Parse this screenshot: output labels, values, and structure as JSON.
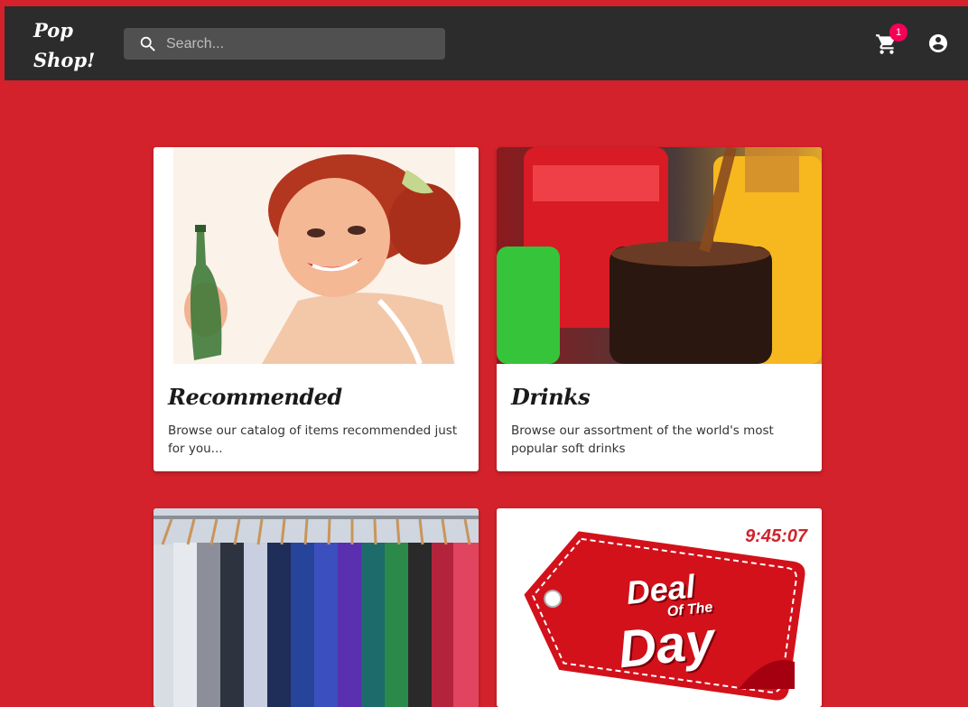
{
  "header": {
    "logo_line1": "Pop",
    "logo_line2": "Shop!",
    "search_placeholder": "Search...",
    "cart_count": "1",
    "icons": [
      "search-icon",
      "cart-icon",
      "account-circle-icon"
    ]
  },
  "colors": {
    "page_background": "#d3222b",
    "header_background": "#2c2c2c",
    "badge": "#f50057"
  },
  "cards": [
    {
      "title": "Recommended",
      "description": "Browse our catalog of items recommended just for you..."
    },
    {
      "title": "Drinks",
      "description": "Browse our assortment of the world's most popular soft drinks"
    }
  ],
  "deal": {
    "timer": "9:45:07",
    "line1": "Deal",
    "line2": "Of The",
    "line3": "Day"
  }
}
